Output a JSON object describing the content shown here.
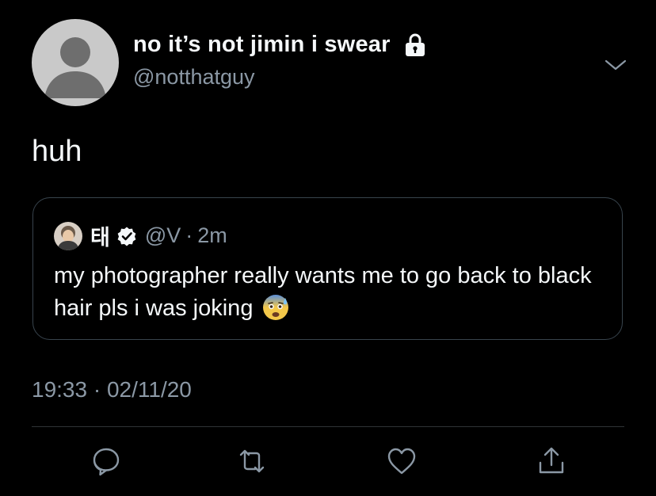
{
  "tweet": {
    "display_name": "no it’s not jimin i swear",
    "handle": "@notthatguy",
    "text": "huh",
    "timestamp_time": "19:33",
    "timestamp_sep": "·",
    "timestamp_date": "02/11/20"
  },
  "quote": {
    "name": "태",
    "handle": "@V",
    "sep": "·",
    "time": "2m",
    "text": "my photographer really wants me to go back to black hair pls i was joking"
  },
  "icons": {
    "lock": "lock-icon",
    "chevron": "chevron-down-icon",
    "verified": "verified-badge-icon",
    "emoji": "anxious-face-with-sweat-emoji",
    "reply": "reply-icon",
    "retweet": "retweet-icon",
    "like": "heart-icon",
    "share": "share-icon"
  },
  "colors": {
    "background": "#000000",
    "text_primary": "#f5f8fa",
    "text_secondary": "#8b98a5",
    "border": "#38444d"
  }
}
